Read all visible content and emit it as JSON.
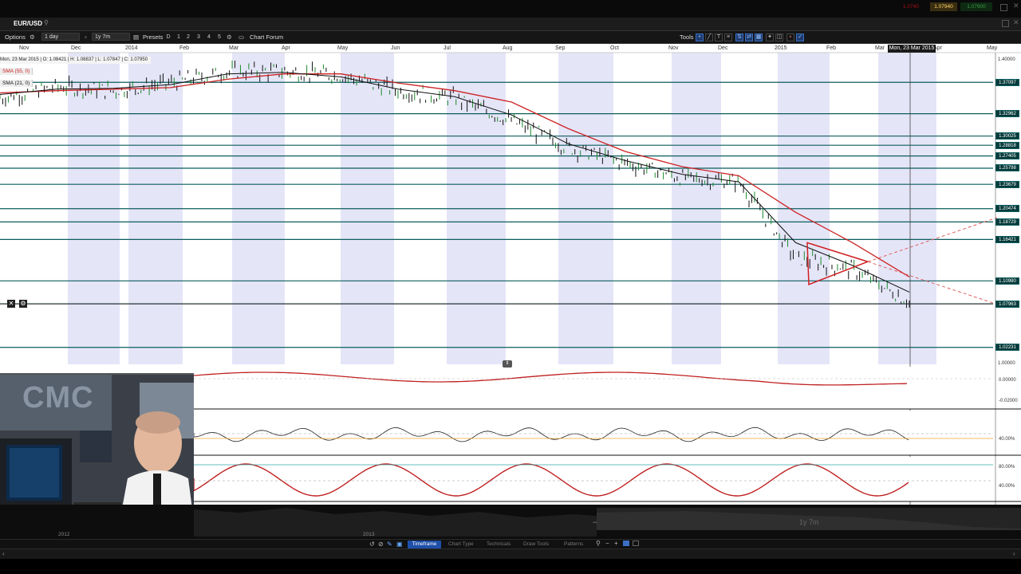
{
  "window": {
    "symbol": "EUR/USD",
    "top_price_red": "1.0740",
    "top_price": "1.07940",
    "top_price_green": "1.07900"
  },
  "toolbar": {
    "options_label": "Options",
    "interval_value": "1 day",
    "range_value": "1y 7m",
    "presets_label": "Presets",
    "preset_numbers": [
      "D",
      "1",
      "2",
      "3",
      "4",
      "5"
    ],
    "chart_forum_label": "Chart Forum",
    "tools_label": "Tools"
  },
  "chart": {
    "info_bar": "Mon, 23 Mar 2015 | O: 1.08421 | H: 1.08837 | L: 1.07847 | C: 1.07950",
    "sma_fast": "SMA (55, 0)",
    "sma_slow": "SMA (21, 0)",
    "date_tooltip": "Mon, 23 Mar 2015",
    "months": [
      "Nov",
      "Dec",
      "2014",
      "Feb",
      "Mar",
      "Apr",
      "May",
      "Jun",
      "Jul",
      "Aug",
      "Sep",
      "Oct",
      "Nov",
      "Dec",
      "2015",
      "Feb",
      "Mar",
      "Apr",
      "May"
    ],
    "price_levels": [
      "1.37097",
      "1.32962",
      "1.30025",
      "1.28818",
      "1.27405",
      "1.25798",
      "1.23679",
      "1.20474",
      "1.18729",
      "1.16421",
      "1.10980",
      "1.07963",
      "1.02231"
    ],
    "price_ticks": [
      "1.40000",
      "1.00000"
    ],
    "indicator_ticks": {
      "macd": [
        "0.00000",
        "-0.02000"
      ],
      "rsi": [
        "40.00%"
      ],
      "stoch": [
        "80.00%",
        "40.00%"
      ]
    },
    "colors": {
      "sma_fast": "#cc2222",
      "sma_slow": "#111111",
      "level_line": "#0b5d5d",
      "month_band": "#dcdcf5"
    }
  },
  "chart_data": {
    "type": "line",
    "title": "EUR/USD",
    "xlabel": "",
    "ylabel": "",
    "ylim": [
      1.0,
      1.41
    ],
    "x": [
      "Nov 2013",
      "Dec 2013",
      "Jan 2014",
      "Feb 2014",
      "Mar 2014",
      "Apr 2014",
      "May 2014",
      "Jun 2014",
      "Jul 2014",
      "Aug 2014",
      "Sep 2014",
      "Oct 2014",
      "Nov 2014",
      "Dec 2014",
      "Jan 2015",
      "Feb 2015",
      "Mar 2015"
    ],
    "series": [
      {
        "values": [
          1.35,
          1.365,
          1.36,
          1.37,
          1.385,
          1.385,
          1.38,
          1.36,
          1.35,
          1.32,
          1.285,
          1.265,
          1.245,
          1.24,
          1.14,
          1.125,
          1.082
        ]
      },
      {
        "name": "SMA (55, 0)",
        "values": [
          1.357,
          1.36,
          1.362,
          1.364,
          1.375,
          1.382,
          1.382,
          1.37,
          1.36,
          1.345,
          1.31,
          1.28,
          1.26,
          1.248,
          1.2,
          1.16,
          1.115
        ]
      },
      {
        "name": "SMA (21, 0)",
        "values": [
          1.355,
          1.362,
          1.363,
          1.368,
          1.382,
          1.384,
          1.378,
          1.362,
          1.352,
          1.328,
          1.29,
          1.268,
          1.25,
          1.24,
          1.16,
          1.13,
          1.095
        ]
      }
    ]
  },
  "timeline": {
    "year_a": "2012",
    "year_b": "2013",
    "range_label": "1y 7m"
  },
  "bottom_tabs": [
    "Timeframe",
    "Chart Type",
    "Technicals",
    "Draw Tools",
    "Patterns"
  ],
  "webcam": {
    "logo_text": "CMC"
  }
}
